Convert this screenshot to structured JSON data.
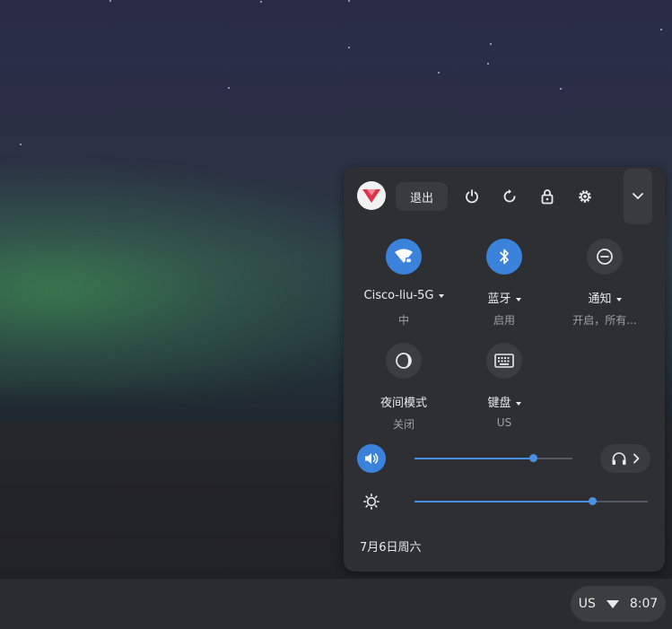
{
  "colors": {
    "accent": "#3b82db",
    "panel": "#2e2f33",
    "shelf": "#2b2c2f",
    "text": "#e8eaed",
    "subtext": "#9aa0a6"
  },
  "top_row": {
    "signout_label": "退出",
    "icons": [
      "avatar",
      "power-icon",
      "restart-icon",
      "lock-icon",
      "settings-icon",
      "chevron-down-icon"
    ]
  },
  "tiles": [
    {
      "label": "Cisco-liu-5G",
      "sub": "中",
      "icon": "wifi-icon",
      "active": true,
      "has_dropdown": true
    },
    {
      "label": "蓝牙",
      "sub": "启用",
      "icon": "bluetooth-icon",
      "active": true,
      "has_dropdown": true
    },
    {
      "label": "通知",
      "sub": "开启，所有...",
      "icon": "do-not-disturb-icon",
      "active": false,
      "has_dropdown": true
    },
    {
      "label": "夜间模式",
      "sub": "关闭",
      "icon": "night-light-icon",
      "active": false,
      "has_dropdown": false
    },
    {
      "label": "键盘",
      "sub": "US",
      "icon": "keyboard-icon",
      "active": false,
      "has_dropdown": true
    }
  ],
  "volume": {
    "level_percent": 75,
    "icon": "volume-icon"
  },
  "brightness": {
    "level_percent": 76,
    "icon": "brightness-icon"
  },
  "audio_output_icon": "headphones-icon",
  "date": "7月6日周六",
  "tray": {
    "ime": "US",
    "time": "8:07",
    "wifi_icon": "wifi-icon"
  }
}
